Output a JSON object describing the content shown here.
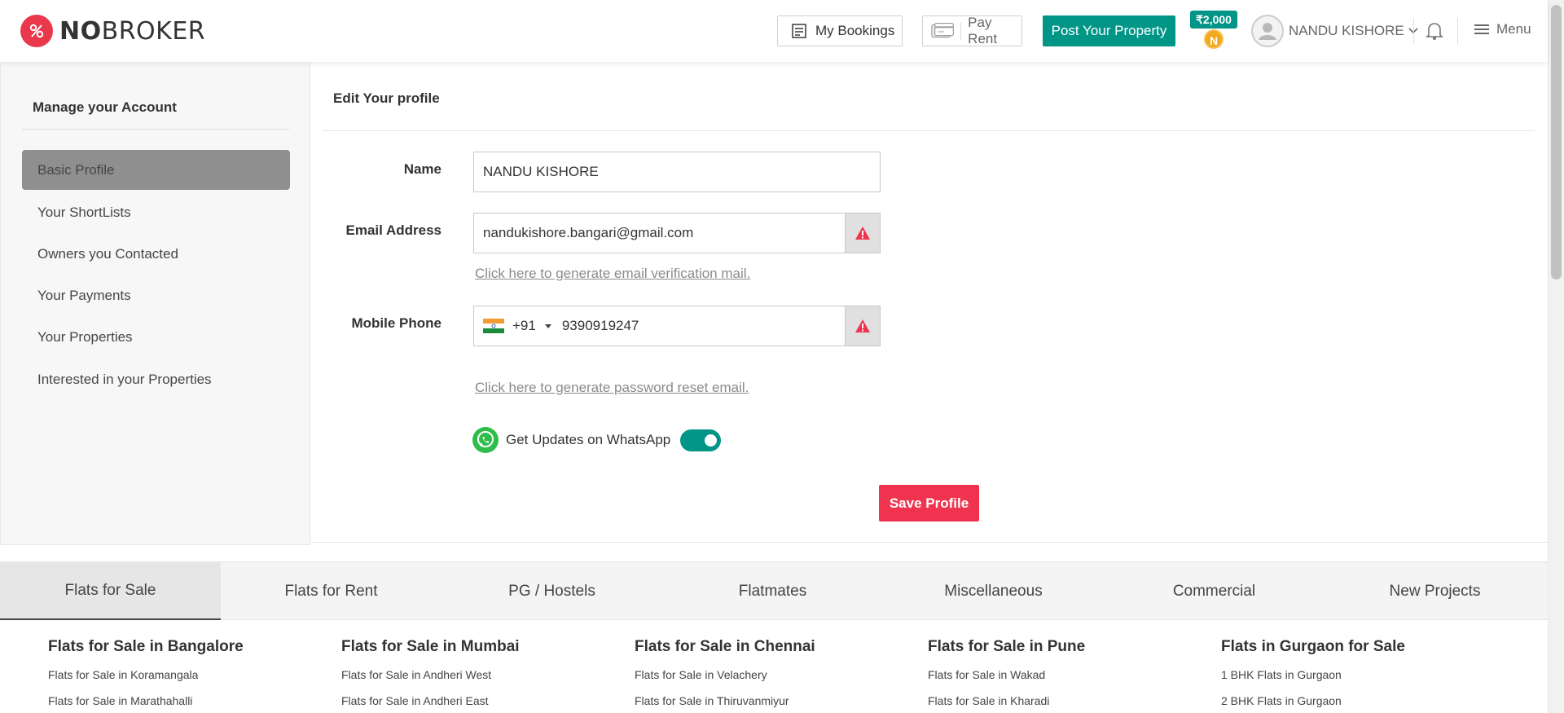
{
  "header": {
    "logo_strong": "NO",
    "logo_light": "BROKER",
    "my_bookings": "My Bookings",
    "pay_rent": "Pay Rent",
    "post_property": "Post Your Property",
    "wallet_amount": "₹2,000",
    "coin_letter": "N",
    "user_name": "NANDU KISHORE",
    "menu_label": "Menu"
  },
  "sidebar": {
    "title": "Manage your Account",
    "items": [
      {
        "label": "Basic Profile",
        "active": true
      },
      {
        "label": "Your ShortLists"
      },
      {
        "label": "Owners you Contacted"
      },
      {
        "label": "Your Payments"
      },
      {
        "label": "Your Properties"
      },
      {
        "label": "Interested in your Properties"
      }
    ]
  },
  "profile": {
    "title": "Edit Your profile",
    "name_label": "Name",
    "name_value": "NANDU KISHORE",
    "email_label": "Email Address",
    "email_value": "nandukishore.bangari@gmail.com",
    "email_verify_link": "Click here to generate email verification mail.",
    "phone_label": "Mobile Phone",
    "country_code": "+91",
    "phone_value": "9390919247",
    "password_reset_link": "Click here to generate password reset email.",
    "whatsapp_label": "Get Updates on WhatsApp",
    "whatsapp_enabled": true,
    "save_label": "Save Profile"
  },
  "footer_tabs": [
    "Flats for Sale",
    "Flats for Rent",
    "PG / Hostels",
    "Flatmates",
    "Miscellaneous",
    "Commercial",
    "New Projects"
  ],
  "footer_columns": [
    {
      "heading": "Flats for Sale in Bangalore",
      "links": [
        "Flats for Sale in Koramangala",
        "Flats for Sale in Marathahalli"
      ]
    },
    {
      "heading": "Flats for Sale in Mumbai",
      "links": [
        "Flats for Sale in Andheri West",
        "Flats for Sale in Andheri East"
      ]
    },
    {
      "heading": "Flats for Sale in Chennai",
      "links": [
        "Flats for Sale in Velachery",
        "Flats for Sale in Thiruvanmiyur"
      ]
    },
    {
      "heading": "Flats for Sale in Pune",
      "links": [
        "Flats for Sale in Wakad",
        "Flats for Sale in Kharadi"
      ]
    },
    {
      "heading": "Flats in Gurgaon for Sale",
      "links": [
        "1 BHK Flats in Gurgaon",
        "2 BHK Flats in Gurgaon"
      ]
    }
  ],
  "colors": {
    "brand_red": "#e9374b",
    "teal": "#009587",
    "save_red": "#f0344f",
    "coin": "#f3a81c"
  }
}
